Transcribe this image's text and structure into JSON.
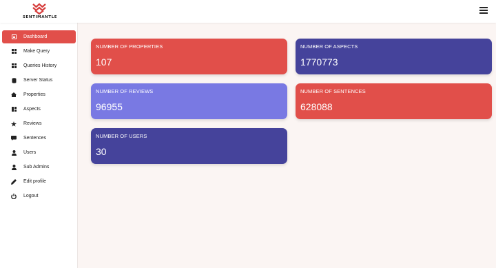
{
  "header": {
    "brand": "SENTIMANTLE",
    "logo_icon": "sentimantle-logo-icon",
    "menu_icon": "hamburger-icon"
  },
  "sidebar": {
    "items": [
      {
        "label": "Dashboard",
        "icon": "dashboard-icon",
        "active": true
      },
      {
        "label": "Make Query",
        "icon": "grid-icon"
      },
      {
        "label": "Queries History",
        "icon": "grid-icon"
      },
      {
        "label": "Server Status",
        "icon": "server-icon"
      },
      {
        "label": "Properties",
        "icon": "home-icon"
      },
      {
        "label": "Aspects",
        "icon": "columns-icon"
      },
      {
        "label": "Reviews",
        "icon": "star-icon"
      },
      {
        "label": "Sentences",
        "icon": "comment-icon"
      },
      {
        "label": "Users",
        "icon": "user-icon"
      },
      {
        "label": "Sub Admins",
        "icon": "user-icon"
      },
      {
        "label": "Edit profile",
        "icon": "pencil-icon"
      },
      {
        "label": "Logout",
        "icon": "power-icon"
      }
    ]
  },
  "cards": [
    {
      "label": "NUMBER OF PROPERTIES",
      "value": "107",
      "color": "#e14f4a"
    },
    {
      "label": "NUMBER OF ASPECTS",
      "value": "1770773",
      "color": "#45439b"
    },
    {
      "label": "NUMBER OF REVIEWS",
      "value": "96955",
      "color": "#7979e3"
    },
    {
      "label": "NUMBER OF SENTENCES",
      "value": "628088",
      "color": "#e14f4a"
    },
    {
      "label": "NUMBER OF USERS",
      "value": "30",
      "color": "#45439b"
    }
  ],
  "colors": {
    "accent": "#e14f4a",
    "indigo": "#45439b",
    "periwinkle": "#7979e3",
    "background": "#fbf5f3"
  }
}
